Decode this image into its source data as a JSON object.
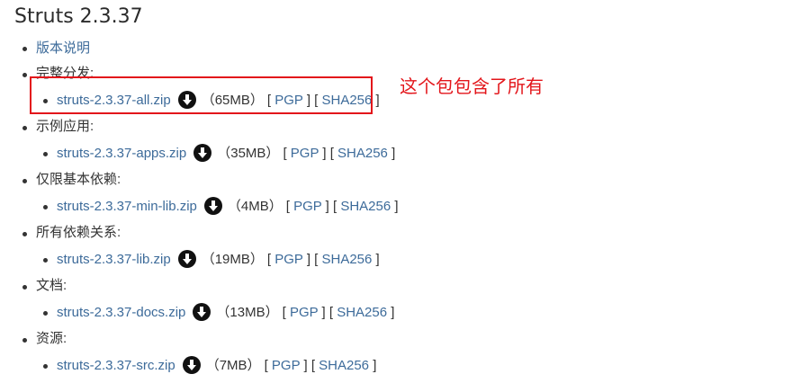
{
  "page": {
    "title": "Struts 2.3.37"
  },
  "annotation": {
    "text": "这个包包含了所有"
  },
  "items": [
    {
      "label": "版本说明",
      "is_link": true
    },
    {
      "label": "完整分发:",
      "file": "struts-2.3.37-all.zip",
      "size": "（65MB）",
      "pgp": "PGP",
      "sha": "SHA256"
    },
    {
      "label": "示例应用:",
      "file": "struts-2.3.37-apps.zip",
      "size": "（35MB）",
      "pgp": "PGP",
      "sha": "SHA256"
    },
    {
      "label": "仅限基本依赖:",
      "file": "struts-2.3.37-min-lib.zip",
      "size": "（4MB）",
      "pgp": "PGP",
      "sha": "SHA256"
    },
    {
      "label": "所有依赖关系:",
      "file": "struts-2.3.37-lib.zip",
      "size": "（19MB）",
      "pgp": "PGP",
      "sha": "SHA256"
    },
    {
      "label": "文档:",
      "file": "struts-2.3.37-docs.zip",
      "size": "（13MB）",
      "pgp": "PGP",
      "sha": "SHA256"
    },
    {
      "label": "资源:",
      "file": "struts-2.3.37-src.zip",
      "size": "（7MB）",
      "pgp": "PGP",
      "sha": "SHA256"
    }
  ],
  "icons": {
    "download": "download-circle-icon"
  },
  "colors": {
    "link": "#3d6b9a",
    "annotation": "#e3161b"
  }
}
